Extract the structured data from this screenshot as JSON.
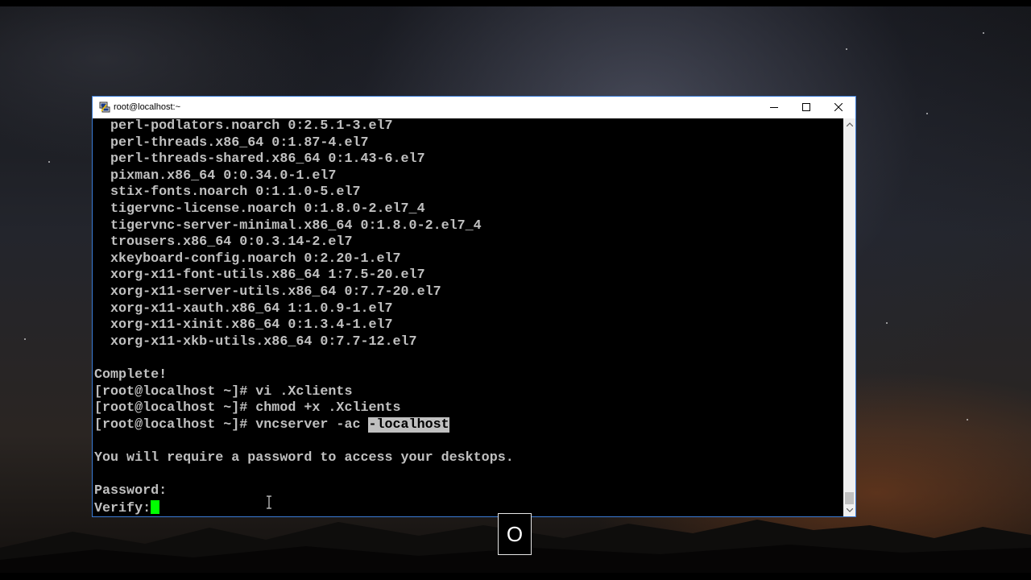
{
  "window": {
    "title": "root@localhost:~",
    "icon": "putty-terminal-icon",
    "buttons": {
      "minimize": "minimize-icon",
      "maximize": "maximize-icon",
      "close": "close-icon"
    }
  },
  "terminal": {
    "lines": [
      "  perl-podlators.noarch 0:2.5.1-3.el7",
      "  perl-threads.x86_64 0:1.87-4.el7",
      "  perl-threads-shared.x86_64 0:1.43-6.el7",
      "  pixman.x86_64 0:0.34.0-1.el7",
      "  stix-fonts.noarch 0:1.1.0-5.el7",
      "  tigervnc-license.noarch 0:1.8.0-2.el7_4",
      "  tigervnc-server-minimal.x86_64 0:1.8.0-2.el7_4",
      "  trousers.x86_64 0:0.3.14-2.el7",
      "  xkeyboard-config.noarch 0:2.20-1.el7",
      "  xorg-x11-font-utils.x86_64 1:7.5-20.el7",
      "  xorg-x11-server-utils.x86_64 0:7.7-20.el7",
      "  xorg-x11-xauth.x86_64 1:1.0.9-1.el7",
      "  xorg-x11-xinit.x86_64 0:1.3.4-1.el7",
      "  xorg-x11-xkb-utils.x86_64 0:7.7-12.el7",
      "",
      "Complete!",
      "[root@localhost ~]# vi .Xclients",
      "[root@localhost ~]# chmod +x .Xclients"
    ],
    "vnc_prompt": "[root@localhost ~]# vncserver -ac ",
    "vnc_selected": "-localhost",
    "blank": "",
    "message": "You will require a password to access your desktops.",
    "password_label": "Password:",
    "verify_label": "Verify:"
  },
  "key_overlay": {
    "key": "O"
  },
  "colors": {
    "terminal_bg": "#000000",
    "terminal_fg": "#c0c0c0",
    "cursor": "#00ff00",
    "window_border": "#3a7bd5"
  }
}
